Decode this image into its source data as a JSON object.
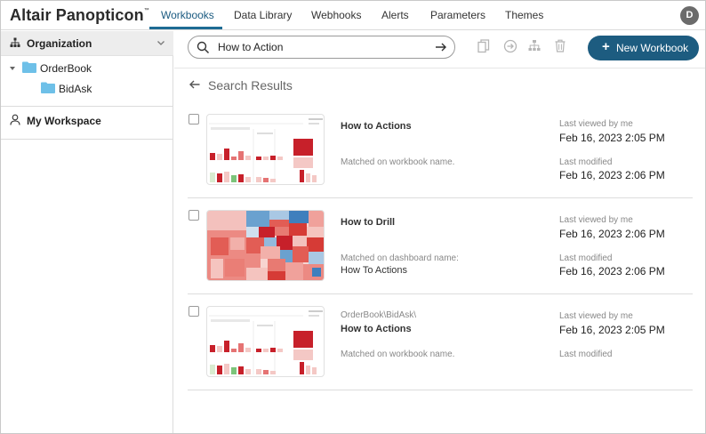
{
  "app": {
    "logo": "Altair Panopticon",
    "logo_tm": "™",
    "avatar_initial": "D"
  },
  "nav": {
    "tabs": [
      "Workbooks",
      "Data Library",
      "Webhooks",
      "Alerts",
      "Parameters",
      "Themes"
    ],
    "active_tab": "Workbooks"
  },
  "sidebar": {
    "organization_label": "Organization",
    "tree": [
      {
        "label": "OrderBook",
        "expanded": true
      },
      {
        "label": "BidAsk"
      }
    ],
    "workspace_label": "My Workspace"
  },
  "toolbar": {
    "search_value": "How to Action",
    "new_workbook_label": "New Workbook",
    "icons": [
      "copy-icon",
      "move-icon",
      "hierarchy-icon",
      "trash-icon"
    ]
  },
  "results": {
    "title": "Search Results",
    "items": [
      {
        "path": "",
        "name": "How to Actions",
        "matched": "Matched on workbook name.",
        "matched_detail": "",
        "last_viewed_label": "Last viewed by me",
        "last_viewed": "Feb 16, 2023 2:05 PM",
        "last_modified_label": "Last modified",
        "last_modified": "Feb 16, 2023 2:06 PM"
      },
      {
        "path": "",
        "name": "How to Drill",
        "matched": "Matched on dashboard name:",
        "matched_detail": "How To Actions",
        "last_viewed_label": "Last viewed by me",
        "last_viewed": "Feb 16, 2023 2:06 PM",
        "last_modified_label": "Last modified",
        "last_modified": "Feb 16, 2023 2:06 PM"
      },
      {
        "path": "OrderBook\\BidAsk\\",
        "name": "How to Actions",
        "matched": "Matched on workbook name.",
        "matched_detail": "",
        "last_viewed_label": "Last viewed by me",
        "last_viewed": "Feb 16, 2023 2:05 PM",
        "last_modified_label": "Last modified",
        "last_modified": ""
      }
    ]
  },
  "colors": {
    "accent": "#1d5c80",
    "tab_active": "#1a5a80",
    "folder": "#6ec0e8"
  }
}
